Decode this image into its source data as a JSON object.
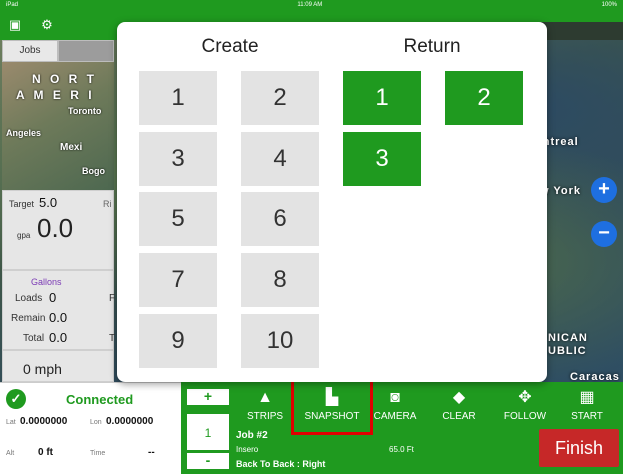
{
  "status_bar": {
    "left": "iPad",
    "time": "11:09 AM",
    "battery": "100%"
  },
  "left_panel": {
    "tabs": [
      "Jobs",
      ""
    ],
    "mini_map_labels": [
      "N O R T",
      "A M E R I",
      "Toronto",
      "Angeles",
      "Mexi",
      "Bogo"
    ],
    "target_label": "Target",
    "target_value": "5.0",
    "rate_unit": "gpa",
    "rate_value": "0.0",
    "right_partial": "Ri",
    "gallons_title": "Gallons",
    "loads_label": "Loads",
    "loads_value": "0",
    "remain_label": "Remain",
    "remain_value": "0.0",
    "total_label": "Total",
    "total_value": "0.0",
    "f_partial": "F",
    "t_partial": "T",
    "speed": "0 mph"
  },
  "map": {
    "labels": [
      "ontreal",
      "w York",
      "NICAN",
      "UBLIC",
      "Caracas"
    ]
  },
  "connection": {
    "status": "Connected",
    "lat_label": "Lat",
    "lat_value": "0.0000000",
    "lon_label": "Lon",
    "lon_value": "0.0000000",
    "alt_label": "Alt",
    "alt_value": "0 ft",
    "time_label": "Time",
    "time_value": "--"
  },
  "toolbar": {
    "plus": "+",
    "minus": "-",
    "stepper_value": "1",
    "strips": "STRIPS",
    "snapshot": "SNAPSHOT",
    "camera": "CAMERA",
    "clear": "CLEAR",
    "follow": "FOLLOW",
    "start": "START",
    "job_name": "Job #2",
    "product": "Insero",
    "width": "65.0 Ft",
    "pattern": "Back To Back : Right",
    "finish": "Finish"
  },
  "modal": {
    "create_title": "Create",
    "return_title": "Return",
    "create_items": [
      "1",
      "2",
      "3",
      "4",
      "5",
      "6",
      "7",
      "8",
      "9",
      "10"
    ],
    "return_items": [
      "1",
      "2",
      "3"
    ]
  },
  "zoom": {
    "in": "+",
    "out": "−"
  },
  "colors": {
    "accent": "#1f9a1f",
    "finish": "#c62828",
    "zoom": "#1e6fe0",
    "highlight": "#e00000"
  }
}
